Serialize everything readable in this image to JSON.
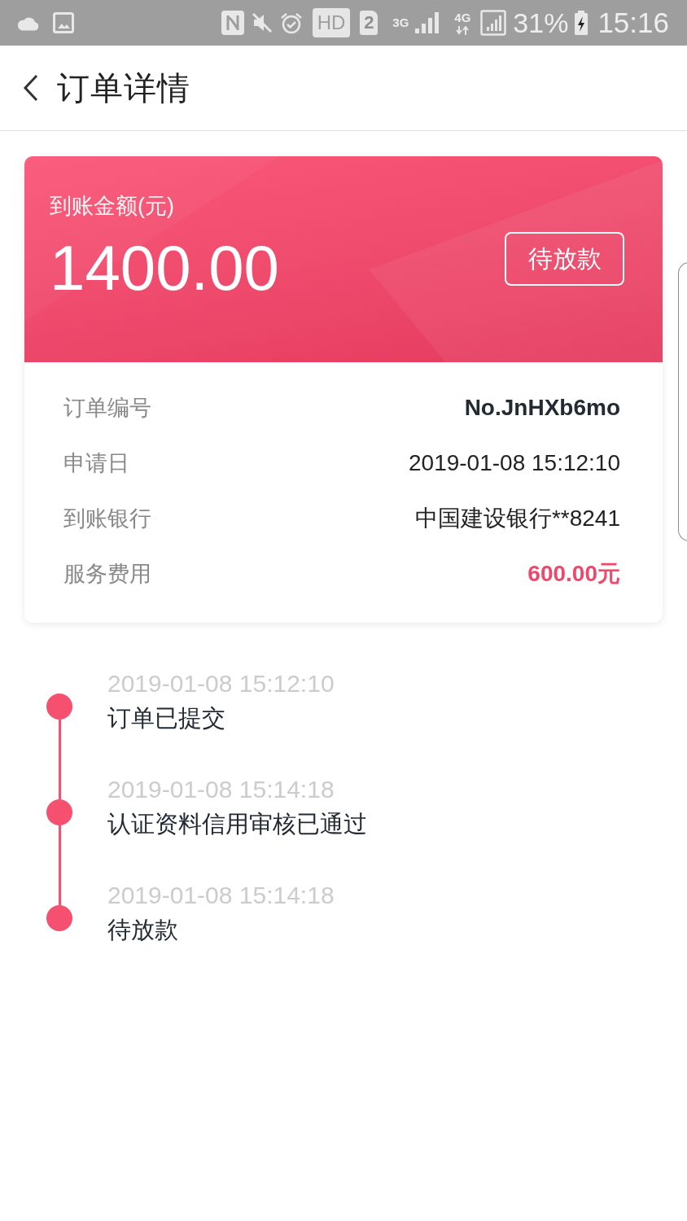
{
  "status_bar": {
    "hd_label": "HD",
    "sim_slot": "2",
    "network_primary": "3G",
    "network_secondary": "4G",
    "battery": "31%",
    "time": "15:16"
  },
  "header": {
    "title": "订单详情"
  },
  "summary": {
    "label": "到账金额(元)",
    "amount": "1400.00",
    "status": "待放款"
  },
  "details": [
    {
      "label": "订单编号",
      "value": "No.JnHXb6mo",
      "kind": "bold"
    },
    {
      "label": "申请日",
      "value": "2019-01-08 15:12:10",
      "kind": "plain"
    },
    {
      "label": "到账银行",
      "value": "中国建设银行**8241",
      "kind": "plain"
    },
    {
      "label": "服务费用",
      "value": "600.00元",
      "kind": "highlight"
    }
  ],
  "timeline": [
    {
      "time": "2019-01-08 15:12:10",
      "event": "订单已提交"
    },
    {
      "time": "2019-01-08 15:14:18",
      "event": "认证资料信用审核已通过"
    },
    {
      "time": "2019-01-08 15:14:18",
      "event": "待放款"
    }
  ]
}
